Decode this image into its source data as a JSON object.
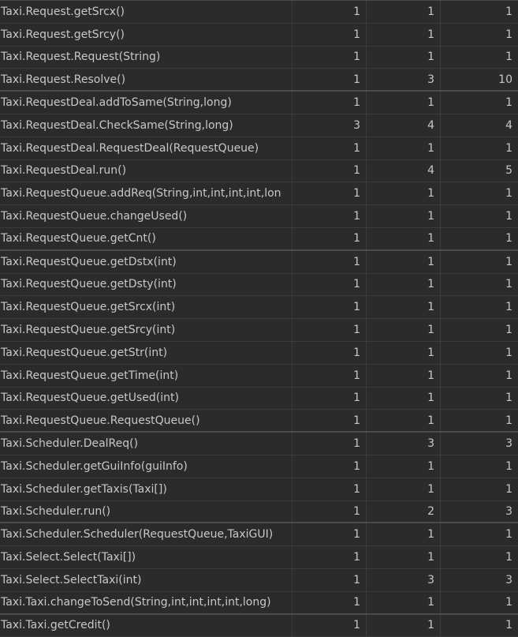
{
  "rows": [
    {
      "method": "Taxi.Request.getSrcx()",
      "v1": "1",
      "v2": "1",
      "v3": "1"
    },
    {
      "method": "Taxi.Request.getSrcy()",
      "v1": "1",
      "v2": "1",
      "v3": "1"
    },
    {
      "method": "Taxi.Request.Request(String)",
      "v1": "1",
      "v2": "1",
      "v3": "1"
    },
    {
      "method": "Taxi.Request.Resolve()",
      "v1": "1",
      "v2": "3",
      "v3": "10"
    },
    {
      "method": "Taxi.RequestDeal.addToSame(String,long)",
      "v1": "1",
      "v2": "1",
      "v3": "1"
    },
    {
      "method": "Taxi.RequestDeal.CheckSame(String,long)",
      "v1": "3",
      "v2": "4",
      "v3": "4"
    },
    {
      "method": "Taxi.RequestDeal.RequestDeal(RequestQueue)",
      "v1": "1",
      "v2": "1",
      "v3": "1"
    },
    {
      "method": "Taxi.RequestDeal.run()",
      "v1": "1",
      "v2": "4",
      "v3": "5"
    },
    {
      "method": "Taxi.RequestQueue.addReq(String,int,int,int,int,lon",
      "v1": "1",
      "v2": "1",
      "v3": "1"
    },
    {
      "method": "Taxi.RequestQueue.changeUsed()",
      "v1": "1",
      "v2": "1",
      "v3": "1"
    },
    {
      "method": "Taxi.RequestQueue.getCnt()",
      "v1": "1",
      "v2": "1",
      "v3": "1"
    },
    {
      "method": "Taxi.RequestQueue.getDstx(int)",
      "v1": "1",
      "v2": "1",
      "v3": "1"
    },
    {
      "method": "Taxi.RequestQueue.getDsty(int)",
      "v1": "1",
      "v2": "1",
      "v3": "1"
    },
    {
      "method": "Taxi.RequestQueue.getSrcx(int)",
      "v1": "1",
      "v2": "1",
      "v3": "1"
    },
    {
      "method": "Taxi.RequestQueue.getSrcy(int)",
      "v1": "1",
      "v2": "1",
      "v3": "1"
    },
    {
      "method": "Taxi.RequestQueue.getStr(int)",
      "v1": "1",
      "v2": "1",
      "v3": "1"
    },
    {
      "method": "Taxi.RequestQueue.getTime(int)",
      "v1": "1",
      "v2": "1",
      "v3": "1"
    },
    {
      "method": "Taxi.RequestQueue.getUsed(int)",
      "v1": "1",
      "v2": "1",
      "v3": "1"
    },
    {
      "method": "Taxi.RequestQueue.RequestQueue()",
      "v1": "1",
      "v2": "1",
      "v3": "1"
    },
    {
      "method": "Taxi.Scheduler.DealReq()",
      "v1": "1",
      "v2": "3",
      "v3": "3"
    },
    {
      "method": "Taxi.Scheduler.getGuiInfo(guiInfo)",
      "v1": "1",
      "v2": "1",
      "v3": "1"
    },
    {
      "method": "Taxi.Scheduler.getTaxis(Taxi[])",
      "v1": "1",
      "v2": "1",
      "v3": "1"
    },
    {
      "method": "Taxi.Scheduler.run()",
      "v1": "1",
      "v2": "2",
      "v3": "3"
    },
    {
      "method": "Taxi.Scheduler.Scheduler(RequestQueue,TaxiGUI)",
      "v1": "1",
      "v2": "1",
      "v3": "1"
    },
    {
      "method": "Taxi.Select.Select(Taxi[])",
      "v1": "1",
      "v2": "1",
      "v3": "1"
    },
    {
      "method": "Taxi.Select.SelectTaxi(int)",
      "v1": "1",
      "v2": "3",
      "v3": "3"
    },
    {
      "method": "Taxi.Taxi.changeToSend(String,int,int,int,int,long)",
      "v1": "1",
      "v2": "1",
      "v3": "1"
    },
    {
      "method": "Taxi.Taxi.getCredit()",
      "v1": "1",
      "v2": "1",
      "v3": "1"
    }
  ]
}
